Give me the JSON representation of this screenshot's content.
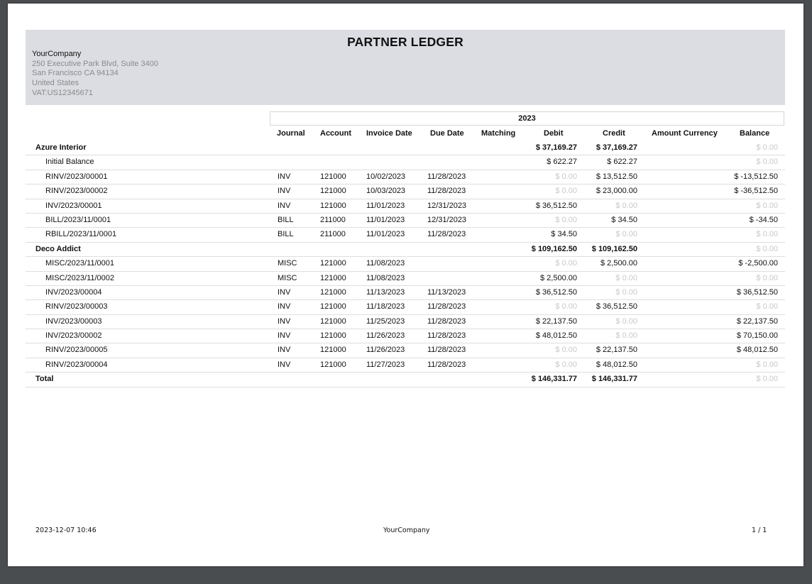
{
  "report": {
    "title": "PARTNER LEDGER",
    "company": {
      "name": "YourCompany",
      "street": "250 Executive Park Blvd, Suite 3400",
      "city": "San Francisco CA 94134",
      "country": "United States",
      "vat": "VAT:US12345671"
    },
    "period": "2023"
  },
  "columns": {
    "journal": "Journal",
    "account": "Account",
    "invoice_date": "Invoice Date",
    "due_date": "Due Date",
    "matching": "Matching",
    "debit": "Debit",
    "credit": "Credit",
    "amount_currency": "Amount Currency",
    "balance": "Balance"
  },
  "rows": [
    {
      "kind": "group",
      "name": "Azure Interior",
      "journal": "",
      "account": "",
      "invoice_date": "",
      "due_date": "",
      "debit": "$ 37,169.27",
      "credit": "$ 37,169.27",
      "balance": "$ 0.00"
    },
    {
      "kind": "line",
      "name": "Initial Balance",
      "journal": "",
      "account": "",
      "invoice_date": "",
      "due_date": "",
      "debit": "$ 622.27",
      "credit": "$ 622.27",
      "balance": "$ 0.00"
    },
    {
      "kind": "line",
      "name": "RINV/2023/00001",
      "journal": "INV",
      "account": "121000",
      "invoice_date": "10/02/2023",
      "due_date": "11/28/2023",
      "debit": "$ 0.00",
      "credit": "$ 13,512.50",
      "balance": "$ -13,512.50"
    },
    {
      "kind": "line",
      "name": "RINV/2023/00002",
      "journal": "INV",
      "account": "121000",
      "invoice_date": "10/03/2023",
      "due_date": "11/28/2023",
      "debit": "$ 0.00",
      "credit": "$ 23,000.00",
      "balance": "$ -36,512.50"
    },
    {
      "kind": "line",
      "name": "INV/2023/00001",
      "journal": "INV",
      "account": "121000",
      "invoice_date": "11/01/2023",
      "due_date": "12/31/2023",
      "debit": "$ 36,512.50",
      "credit": "$ 0.00",
      "balance": "$ 0.00"
    },
    {
      "kind": "line",
      "name": "BILL/2023/11/0001",
      "journal": "BILL",
      "account": "211000",
      "invoice_date": "11/01/2023",
      "due_date": "12/31/2023",
      "debit": "$ 0.00",
      "credit": "$ 34.50",
      "balance": "$ -34.50"
    },
    {
      "kind": "line",
      "name": "RBILL/2023/11/0001",
      "journal": "BILL",
      "account": "211000",
      "invoice_date": "11/01/2023",
      "due_date": "11/28/2023",
      "debit": "$ 34.50",
      "credit": "$ 0.00",
      "balance": "$ 0.00"
    },
    {
      "kind": "group",
      "name": "Deco Addict",
      "journal": "",
      "account": "",
      "invoice_date": "",
      "due_date": "",
      "debit": "$ 109,162.50",
      "credit": "$ 109,162.50",
      "balance": "$ 0.00"
    },
    {
      "kind": "line",
      "name": "MISC/2023/11/0001",
      "journal": "MISC",
      "account": "121000",
      "invoice_date": "11/08/2023",
      "due_date": "",
      "debit": "$ 0.00",
      "credit": "$ 2,500.00",
      "balance": "$ -2,500.00"
    },
    {
      "kind": "line",
      "name": "MISC/2023/11/0002",
      "journal": "MISC",
      "account": "121000",
      "invoice_date": "11/08/2023",
      "due_date": "",
      "debit": "$ 2,500.00",
      "credit": "$ 0.00",
      "balance": "$ 0.00"
    },
    {
      "kind": "line",
      "name": "INV/2023/00004",
      "journal": "INV",
      "account": "121000",
      "invoice_date": "11/13/2023",
      "due_date": "11/13/2023",
      "debit": "$ 36,512.50",
      "credit": "$ 0.00",
      "balance": "$ 36,512.50"
    },
    {
      "kind": "line",
      "name": "RINV/2023/00003",
      "journal": "INV",
      "account": "121000",
      "invoice_date": "11/18/2023",
      "due_date": "11/28/2023",
      "debit": "$ 0.00",
      "credit": "$ 36,512.50",
      "balance": "$ 0.00"
    },
    {
      "kind": "line",
      "name": "INV/2023/00003",
      "journal": "INV",
      "account": "121000",
      "invoice_date": "11/25/2023",
      "due_date": "11/28/2023",
      "debit": "$ 22,137.50",
      "credit": "$ 0.00",
      "balance": "$ 22,137.50"
    },
    {
      "kind": "line",
      "name": "INV/2023/00002",
      "journal": "INV",
      "account": "121000",
      "invoice_date": "11/26/2023",
      "due_date": "11/28/2023",
      "debit": "$ 48,012.50",
      "credit": "$ 0.00",
      "balance": "$ 70,150.00"
    },
    {
      "kind": "line",
      "name": "RINV/2023/00005",
      "journal": "INV",
      "account": "121000",
      "invoice_date": "11/26/2023",
      "due_date": "11/28/2023",
      "debit": "$ 0.00",
      "credit": "$ 22,137.50",
      "balance": "$ 48,012.50"
    },
    {
      "kind": "line",
      "name": "RINV/2023/00004",
      "journal": "INV",
      "account": "121000",
      "invoice_date": "11/27/2023",
      "due_date": "11/28/2023",
      "debit": "$ 0.00",
      "credit": "$ 48,012.50",
      "balance": "$ 0.00"
    },
    {
      "kind": "total",
      "name": "Total",
      "journal": "",
      "account": "",
      "invoice_date": "",
      "due_date": "",
      "debit": "$ 146,331.77",
      "credit": "$ 146,331.77",
      "balance": "$ 0.00"
    }
  ],
  "footer": {
    "timestamp": "2023-12-07 10:46",
    "company": "YourCompany",
    "page": "1 / 1"
  }
}
